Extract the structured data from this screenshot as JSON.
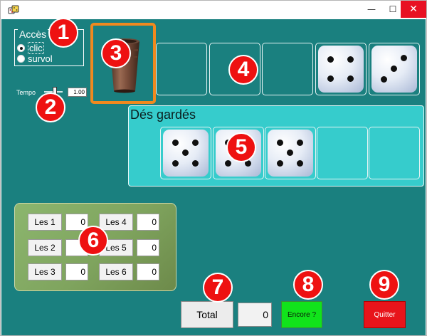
{
  "window": {
    "controls": {
      "minimize": "—",
      "maximize": "☐",
      "close": "✕"
    }
  },
  "acces": {
    "title": "Accès",
    "options": [
      {
        "label": "clic",
        "checked": true
      },
      {
        "label": "survol",
        "checked": false
      }
    ]
  },
  "tempo": {
    "label": "Tempo",
    "value": "1.00"
  },
  "cup": {
    "icon": "dice-cup-icon"
  },
  "rolled_dice": [
    {
      "value": null
    },
    {
      "value": null
    },
    {
      "value": null
    },
    {
      "value": 4
    },
    {
      "value": 3
    }
  ],
  "kept": {
    "title": "Dés gardés",
    "dice": [
      {
        "value": 5
      },
      {
        "value": 5
      },
      {
        "value": 5
      },
      {
        "value": null
      },
      {
        "value": null
      }
    ]
  },
  "scores": [
    {
      "label": "Les 1",
      "value": "0"
    },
    {
      "label": "Les 2",
      "value": ""
    },
    {
      "label": "Les 3",
      "value": "0"
    },
    {
      "label": "Les 4",
      "value": "0"
    },
    {
      "label": "Les 5",
      "value": "0"
    },
    {
      "label": "Les 6",
      "value": "0"
    }
  ],
  "total": {
    "label": "Total",
    "value": "0"
  },
  "actions": {
    "encore": "Encore ?",
    "quitter": "Quitter"
  },
  "markers": [
    "1",
    "2",
    "3",
    "4",
    "5",
    "6",
    "7",
    "8",
    "9"
  ],
  "colors": {
    "background": "#1a807f",
    "cup_border": "#f0891e",
    "kept_panel": "#36cccc",
    "encore": "#11e31b",
    "quitter": "#e8141b",
    "marker": "#ee1111"
  }
}
